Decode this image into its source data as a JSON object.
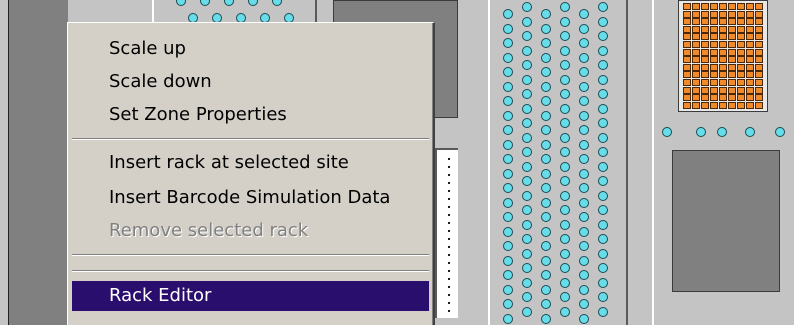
{
  "context_menu": {
    "items": [
      {
        "label": "Scale up",
        "state": "normal"
      },
      {
        "label": "Scale down",
        "state": "normal"
      },
      {
        "label": "Set Zone Properties",
        "state": "normal"
      },
      {
        "label": "Insert rack at selected site",
        "state": "normal"
      },
      {
        "label": "Insert Barcode Simulation Data",
        "state": "normal"
      },
      {
        "label": "Remove selected rack",
        "state": "disabled"
      },
      {
        "label": "Rack Editor",
        "state": "highlighted"
      }
    ]
  },
  "colors": {
    "menu_background": "#d4d0c8",
    "highlight": "#2a0e6e",
    "disabled_text": "#808080",
    "deck_background": "#c4c4c4",
    "well_fill": "#66dde8",
    "tube_fill": "#f08a2a"
  }
}
